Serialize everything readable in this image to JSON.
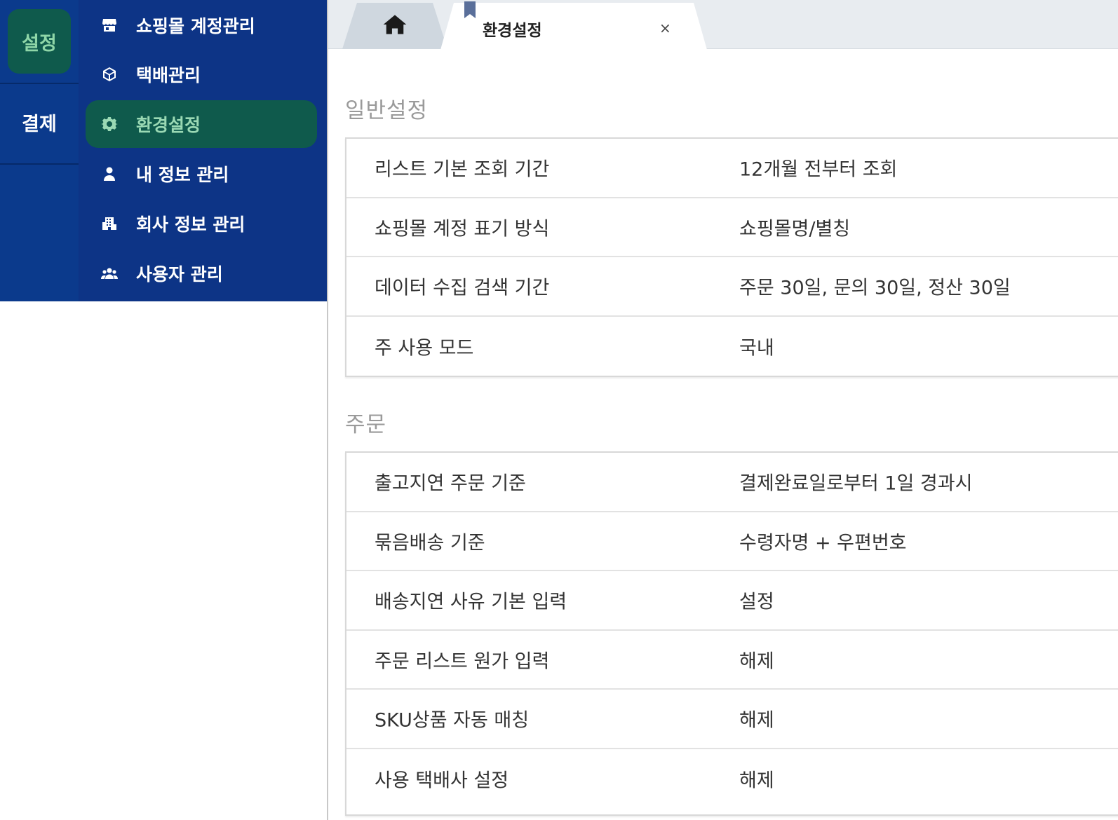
{
  "rail": {
    "items": [
      {
        "label": "설정"
      },
      {
        "label": "결제"
      }
    ]
  },
  "subnav": {
    "items": [
      {
        "label": "쇼핑몰 계정관리",
        "icon": "store-icon"
      },
      {
        "label": "택배관리",
        "icon": "cube-icon"
      },
      {
        "label": "환경설정",
        "icon": "gear-icon"
      },
      {
        "label": "내 정보 관리",
        "icon": "user-icon"
      },
      {
        "label": "회사 정보 관리",
        "icon": "building-icon"
      },
      {
        "label": "사용자 관리",
        "icon": "users-icon"
      }
    ]
  },
  "tabs": {
    "home_icon": "home-icon",
    "active_label": "환경설정",
    "close_label": "×"
  },
  "sections": [
    {
      "title": "일반설정",
      "rows": [
        {
          "key": "리스트 기본 조회 기간",
          "value": "12개월 전부터 조회"
        },
        {
          "key": "쇼핑몰 계정 표기 방식",
          "value": "쇼핑몰명/별칭"
        },
        {
          "key": "데이터 수집 검색 기간",
          "value": "주문 30일, 문의 30일, 정산 30일"
        },
        {
          "key": "주 사용 모드",
          "value": "국내"
        }
      ]
    },
    {
      "title": "주문",
      "rows": [
        {
          "key": "출고지연 주문 기준",
          "value": "결제완료일로부터 1일 경과시"
        },
        {
          "key": "묶음배송 기준",
          "value": "수령자명 + 우편번호"
        },
        {
          "key": "배송지연 사유 기본 입력",
          "value": "설정"
        },
        {
          "key": "주문 리스트 원가 입력",
          "value": "해제"
        },
        {
          "key": "SKU상품 자동 매칭",
          "value": "해제"
        },
        {
          "key": "사용 택배사 설정",
          "value": "해제"
        }
      ]
    }
  ],
  "colors": {
    "rail_bg": "#0b3a8c",
    "subnav_bg": "#0d3486",
    "active_bg": "#0f5a4c",
    "active_text": "#9ad9b4"
  }
}
